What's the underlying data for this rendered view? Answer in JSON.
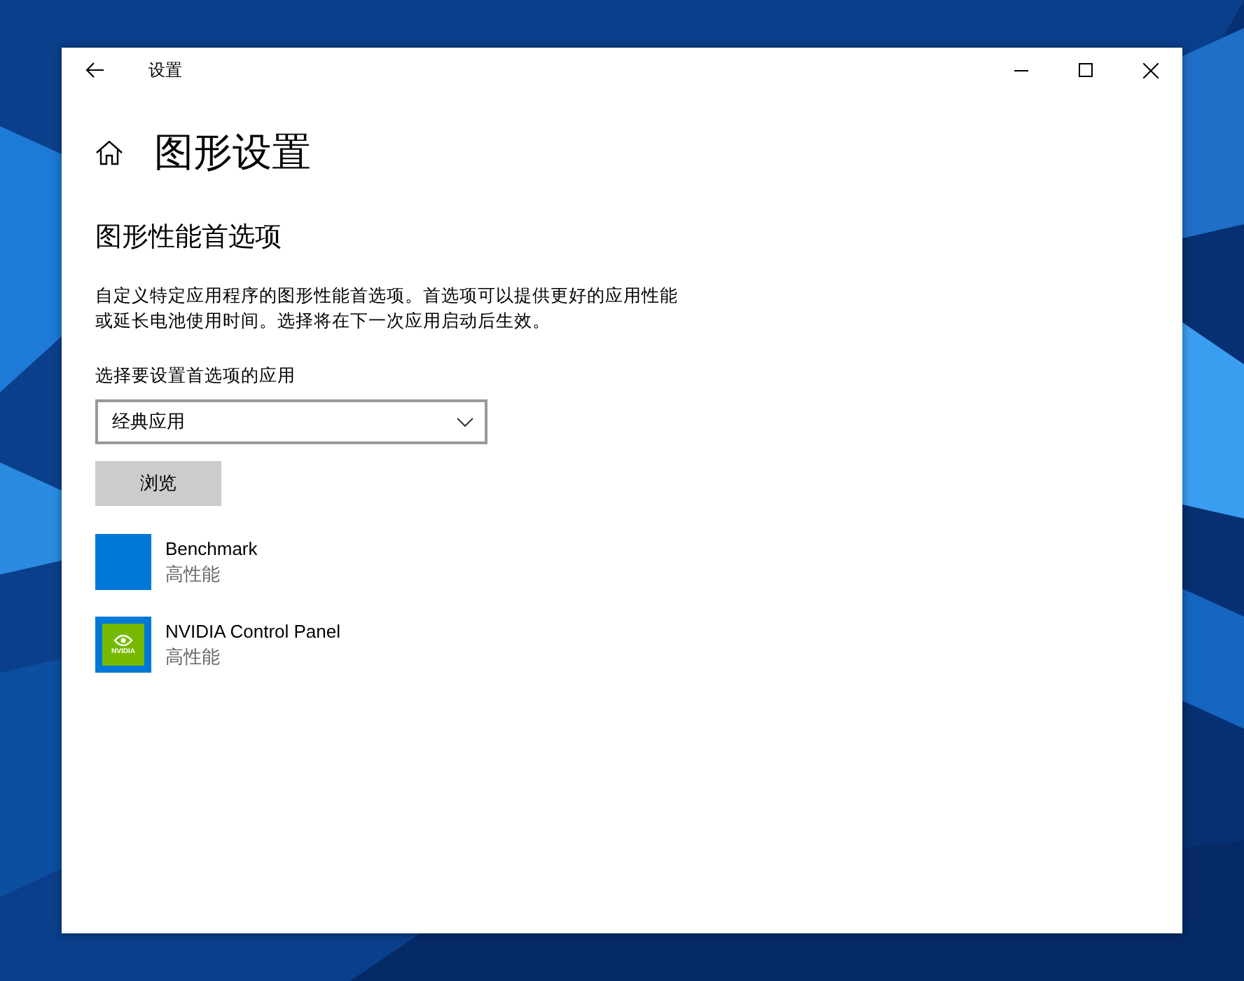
{
  "window": {
    "title": "设置"
  },
  "page": {
    "title": "图形设置"
  },
  "section": {
    "heading": "图形性能首选项",
    "description_lines": [
      "自定义特定应用程序的图形性能首选项。首选项可以提供更好的应用性能",
      "或延长电池使用时间。选择将在下一次应用启动后生效。"
    ]
  },
  "app_picker": {
    "label": "选择要设置首选项的应用",
    "value": "经典应用"
  },
  "browse_button": "浏览",
  "apps": [
    {
      "kind": "plain",
      "name": "Benchmark",
      "preference": "高性能"
    },
    {
      "kind": "nvidia",
      "logo_text": "NVIDIA",
      "name": "NVIDIA Control Panel",
      "preference": "高性能"
    }
  ]
}
